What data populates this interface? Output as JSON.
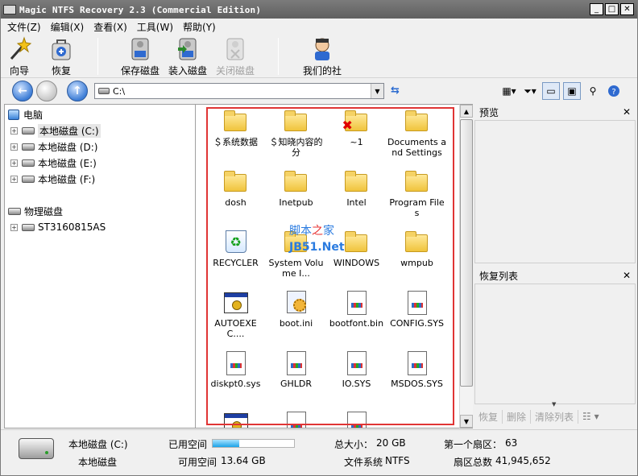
{
  "window": {
    "title": "Magic NTFS Recovery 2.3 (Commercial Edition)",
    "minimize": "_",
    "maximize": "□",
    "close": "✕"
  },
  "menu": [
    "文件(Z)",
    "编辑(X)",
    "查看(X)",
    "工具(W)",
    "帮助(Y)"
  ],
  "toolbar": {
    "wizard": "向导",
    "recover": "恢复",
    "save_disk": "保存磁盘",
    "mount_disk": "装入磁盘",
    "close_disk": "关闭磁盘",
    "our_company": "我们的社"
  },
  "address": {
    "path": "C:\\"
  },
  "tree": {
    "root": "电脑",
    "local_disks": [
      "本地磁盘 (C:)",
      "本地磁盘 (D:)",
      "本地磁盘 (E:)",
      "本地磁盘 (F:)"
    ],
    "physical_root": "物理磁盘",
    "physical_disks": [
      "ST3160815AS"
    ]
  },
  "files": [
    {
      "name": "＄系统数据",
      "type": "folder"
    },
    {
      "name": "＄知晓内容的分",
      "type": "folder"
    },
    {
      "name": "~1",
      "type": "folder-deleted"
    },
    {
      "name": "Documents and Settings",
      "type": "folder"
    },
    {
      "name": "dosh",
      "type": "folder"
    },
    {
      "name": "Inetpub",
      "type": "folder"
    },
    {
      "name": "Intel",
      "type": "folder"
    },
    {
      "name": "Program Files",
      "type": "folder"
    },
    {
      "name": "RECYCLER",
      "type": "recycle"
    },
    {
      "name": "System Volume I...",
      "type": "folder"
    },
    {
      "name": "WINDOWS",
      "type": "folder"
    },
    {
      "name": "wmpub",
      "type": "folder"
    },
    {
      "name": "AUTOEXEC....",
      "type": "app"
    },
    {
      "name": "boot.ini",
      "type": "gear"
    },
    {
      "name": "bootfont.bin",
      "type": "doc"
    },
    {
      "name": "CONFIG.SYS",
      "type": "doc"
    },
    {
      "name": "diskpt0.sys",
      "type": "doc"
    },
    {
      "name": "GHLDR",
      "type": "doc"
    },
    {
      "name": "IO.SYS",
      "type": "doc"
    },
    {
      "name": "MSDOS.SYS",
      "type": "doc"
    },
    {
      "name": "",
      "type": "app"
    },
    {
      "name": "",
      "type": "doc"
    },
    {
      "name": "",
      "type": "doc"
    }
  ],
  "watermark": {
    "line1_a": "脚本",
    "line1_b": "之",
    "line1_c": "家",
    "line2": "JB51.Net"
  },
  "panels": {
    "preview_title": "预览",
    "recovery_list_title": "恢复列表",
    "recover_btn": "恢复",
    "delete_btn": "删除",
    "clear_btn": "清除列表"
  },
  "status": {
    "drive_name": "本地磁盘 (C:)",
    "drive_type": "本地磁盘",
    "used_label": "已用空间",
    "used_fraction": 0.33,
    "free_label": "可用空间",
    "free_value": "13.64 GB",
    "total_label": "总大小：",
    "total_value": "20 GB",
    "fs_label": "文件系统",
    "fs_value": "NTFS",
    "first_sector_label": "第一个扇区：",
    "first_sector_value": "63",
    "sectors_label": "扇区总数",
    "sectors_value": "41,945,652"
  }
}
